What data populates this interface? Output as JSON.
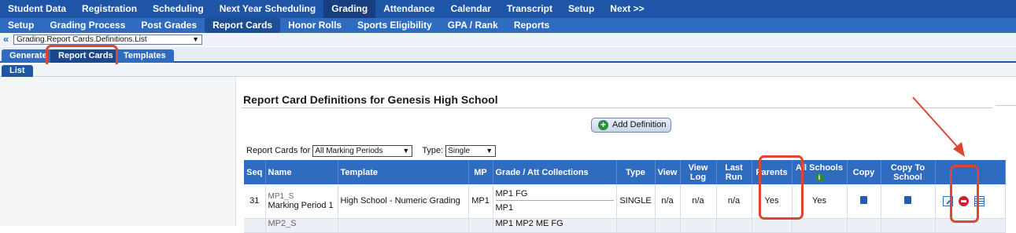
{
  "nav_primary": [
    "Student Data",
    "Registration",
    "Scheduling",
    "Next Year Scheduling",
    "Grading",
    "Attendance",
    "Calendar",
    "Transcript",
    "Setup",
    "Next >>"
  ],
  "nav_primary_active": "Grading",
  "nav_secondary": [
    "Setup",
    "Grading Process",
    "Post Grades",
    "Report Cards",
    "Honor Rolls",
    "Sports Eligibility",
    "GPA / Rank",
    "Reports"
  ],
  "nav_secondary_active": "Report Cards",
  "path_select": {
    "chevron": "«",
    "value": "Grading.Report Cards.Definitions.List"
  },
  "tabs": [
    "Generate",
    "Report Cards",
    "Templates"
  ],
  "subtab": "List",
  "title": "Report Card Definitions for Genesis High School",
  "add_button": "Add Definition",
  "filter": {
    "report_cards_for_label": "Report Cards for",
    "report_cards_for_value": "All Marking Periods",
    "type_label": "Type:",
    "type_value": "Single"
  },
  "table": {
    "headers": {
      "seq": "Seq",
      "name": "Name",
      "template": "Template",
      "mp": "MP",
      "collections": "Grade / Att Collections",
      "type": "Type",
      "view": "View",
      "view_log": "View Log",
      "last_run": "Last Run",
      "parents": "Parents",
      "all_schools": "All Schools",
      "copy": "Copy",
      "copy_to_school": "Copy To School"
    },
    "rows": [
      {
        "seq": "31",
        "code": "MP1_S",
        "name": "Marking Period 1",
        "template": "High School - Numeric Grading",
        "mp": "MP1",
        "collections": [
          "MP1 FG",
          "MP1"
        ],
        "type": "SINGLE",
        "view": "n/a",
        "view_log": "n/a",
        "last_run": "n/a",
        "parents": "Yes",
        "all_schools": "Yes"
      },
      {
        "code": "MP2_S",
        "collections_partial": "MP1 MP2 ME FG"
      }
    ]
  },
  "icons": {
    "info": "i",
    "add": "+"
  },
  "colors": {
    "nav_bg": "#1f55a6",
    "nav2_bg": "#2f6cc0",
    "highlight": "#e0452f",
    "add_green": "#2e8b3a",
    "delete_red": "#d0212a"
  }
}
